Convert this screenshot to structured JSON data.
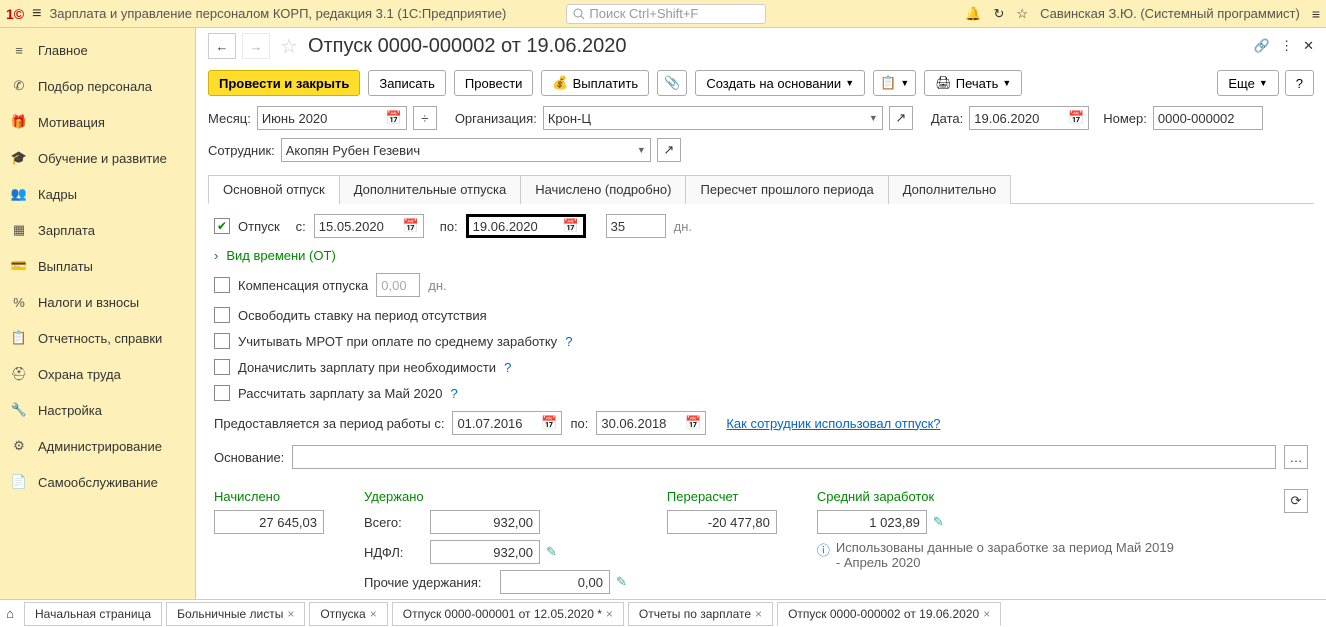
{
  "app": {
    "title": "Зарплата и управление персоналом КОРП, редакция 3.1  (1С:Предприятие)",
    "search_placeholder": "Поиск Ctrl+Shift+F",
    "user": "Савинская З.Ю. (Системный программист)"
  },
  "sidebar": {
    "items": [
      {
        "label": "Главное"
      },
      {
        "label": "Подбор персонала"
      },
      {
        "label": "Мотивация"
      },
      {
        "label": "Обучение и развитие"
      },
      {
        "label": "Кадры"
      },
      {
        "label": "Зарплата"
      },
      {
        "label": "Выплаты"
      },
      {
        "label": "Налоги и взносы"
      },
      {
        "label": "Отчетность, справки"
      },
      {
        "label": "Охрана труда"
      },
      {
        "label": "Настройка"
      },
      {
        "label": "Администрирование"
      },
      {
        "label": "Самообслуживание"
      }
    ]
  },
  "doc": {
    "title": "Отпуск 0000-000002 от 19.06.2020",
    "toolbar": {
      "post_close": "Провести и закрыть",
      "write": "Записать",
      "post": "Провести",
      "pay": "Выплатить",
      "create_based": "Создать на основании",
      "print": "Печать",
      "more": "Еще",
      "help": "?"
    },
    "fields": {
      "month_label": "Месяц:",
      "month_value": "Июнь 2020",
      "org_label": "Организация:",
      "org_value": "Крон-Ц",
      "date_label": "Дата:",
      "date_value": "19.06.2020",
      "number_label": "Номер:",
      "number_value": "0000-000002",
      "employee_label": "Сотрудник:",
      "employee_value": "Акопян Рубен Гезевич"
    },
    "tabs": [
      {
        "label": "Основной отпуск",
        "active": true
      },
      {
        "label": "Дополнительные отпуска"
      },
      {
        "label": "Начислено (подробно)"
      },
      {
        "label": "Пересчет прошлого периода"
      },
      {
        "label": "Дополнительно"
      }
    ],
    "main_tab": {
      "vacation_chk": true,
      "vacation_label": "Отпуск",
      "from_label": "с:",
      "from_value": "15.05.2020",
      "to_label": "по:",
      "to_value": "19.06.2020",
      "days_value": "35",
      "days_label": "дн.",
      "time_type_link": "Вид времени (ОТ)",
      "compensation_label": "Компенсация отпуска",
      "compensation_days": "0,00",
      "compensation_days_label": "дн.",
      "release_rate_label": "Освободить ставку на период отсутствия",
      "mrot_label": "Учитывать МРОТ при оплате по среднему заработку",
      "accrue_salary_label": "Доначислить зарплату при необходимости",
      "calc_salary_label": "Рассчитать зарплату за Май 2020",
      "period_label": "Предоставляется за период работы с:",
      "period_from": "01.07.2016",
      "period_to_label": "по:",
      "period_to": "30.06.2018",
      "usage_link": "Как сотрудник использовал отпуск?",
      "basis_label": "Основание:"
    },
    "totals": {
      "accrued_hdr": "Начислено",
      "accrued_val": "27 645,03",
      "withheld_hdr": "Удержано",
      "total_label": "Всего:",
      "total_val": "932,00",
      "ndfl_label": "НДФЛ:",
      "ndfl_val": "932,00",
      "other_label": "Прочие удержания:",
      "other_val": "0,00",
      "recalc_hdr": "Перерасчет",
      "recalc_val": "-20 477,80",
      "avg_hdr": "Средний заработок",
      "avg_val": "1 023,89",
      "info_text": "Использованы данные о заработке за период Май 2019 - Апрель 2020"
    }
  },
  "bottom_tabs": [
    {
      "label": "Начальная страница",
      "closable": false
    },
    {
      "label": "Больничные листы",
      "closable": true
    },
    {
      "label": "Отпуска",
      "closable": true
    },
    {
      "label": "Отпуск 0000-000001 от 12.05.2020 *",
      "closable": true
    },
    {
      "label": "Отчеты по зарплате",
      "closable": true
    },
    {
      "label": "Отпуск 0000-000002 от 19.06.2020",
      "closable": true,
      "active": true
    }
  ]
}
